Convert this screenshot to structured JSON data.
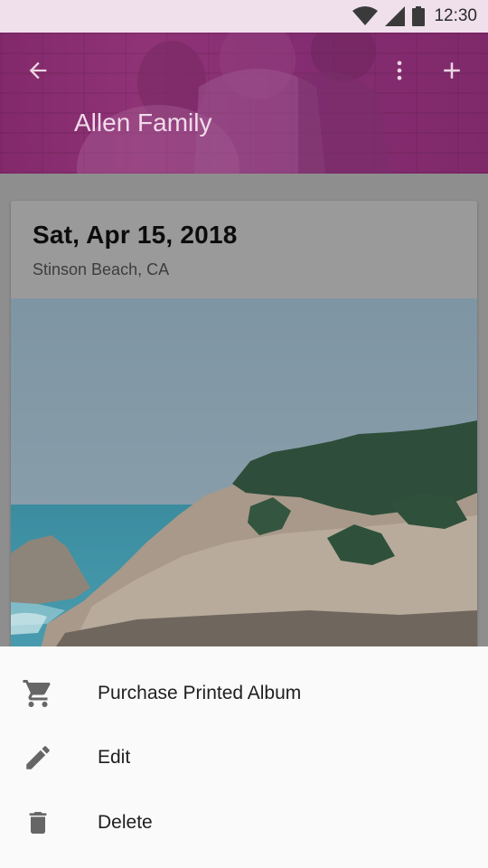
{
  "status_bar": {
    "time": "12:30",
    "icons": [
      "wifi-icon",
      "signal-icon",
      "battery-icon"
    ]
  },
  "app_bar": {
    "title": "Allen Family",
    "back_icon": "arrow-back-icon",
    "menu_icon": "more-vert-icon",
    "add_icon": "add-icon",
    "accent": "#8d3a75"
  },
  "card": {
    "date": "Sat, Apr 15, 2018",
    "location": "Stinson Beach, CA"
  },
  "bottom_sheet": {
    "items": [
      {
        "label": "Purchase Printed Album",
        "icon": "cart-icon"
      },
      {
        "label": "Edit",
        "icon": "edit-pencil-icon"
      },
      {
        "label": "Delete",
        "icon": "trash-icon"
      }
    ]
  }
}
